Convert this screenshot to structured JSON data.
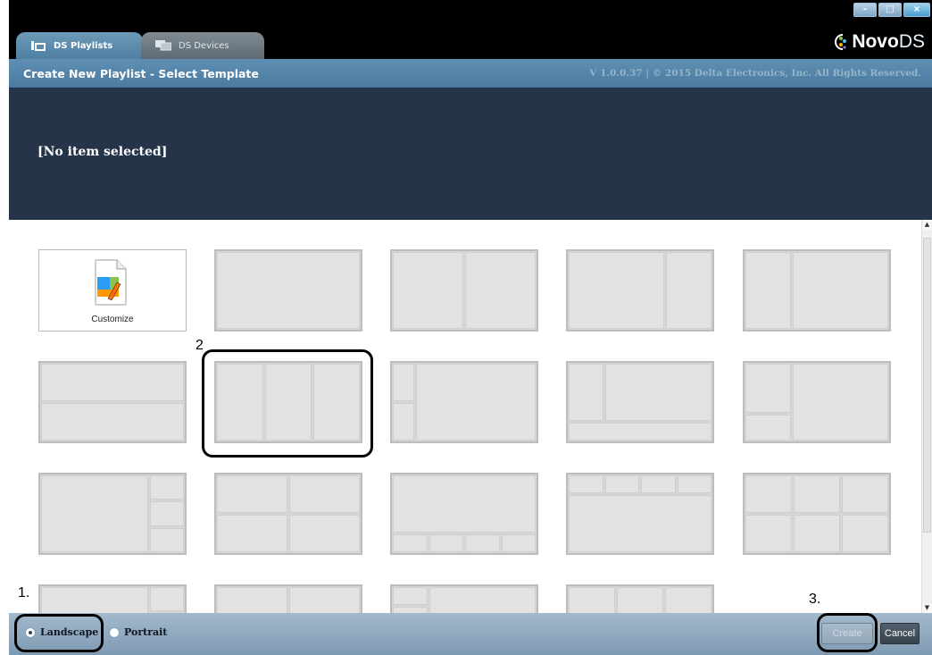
{
  "window": {
    "tabs": [
      {
        "label": "DS Playlists",
        "active": true
      },
      {
        "label": "DS Devices",
        "active": false
      }
    ],
    "controls": {
      "minimize": "-",
      "maximize": "□",
      "close": "×"
    },
    "logo": {
      "novo": "Novo",
      "ds": "DS"
    }
  },
  "header": {
    "title": "Create New Playlist - Select Template",
    "version": "V 1.0.0.37  |  © 2015 Delta Electronics, Inc. All Rights Reserved."
  },
  "banner": {
    "selection": "[No item selected]"
  },
  "templates": {
    "customize_label": "Customize",
    "layouts": [
      {
        "row": 0,
        "col": 1,
        "cells": [
          [
            0,
            0,
            1,
            1
          ]
        ]
      },
      {
        "row": 0,
        "col": 2,
        "cells": [
          [
            0,
            0,
            0.5,
            1
          ],
          [
            0.5,
            0,
            0.5,
            1
          ]
        ]
      },
      {
        "row": 0,
        "col": 3,
        "cells": [
          [
            0,
            0,
            0.67,
            1
          ],
          [
            0.67,
            0,
            0.33,
            1
          ]
        ]
      },
      {
        "row": 0,
        "col": 4,
        "cells": [
          [
            0,
            0,
            0.33,
            1
          ],
          [
            0.33,
            0,
            0.67,
            1
          ]
        ]
      },
      {
        "row": 1,
        "col": 0,
        "cells": [
          [
            0,
            0,
            1,
            0.5
          ],
          [
            0,
            0.5,
            1,
            0.5
          ]
        ]
      },
      {
        "row": 1,
        "col": 1,
        "cells": [
          [
            0,
            0,
            0.333,
            1
          ],
          [
            0.333,
            0,
            0.333,
            1
          ],
          [
            0.666,
            0,
            0.334,
            1
          ]
        ]
      },
      {
        "row": 1,
        "col": 2,
        "cells": [
          [
            0,
            0,
            0.16,
            0.5
          ],
          [
            0,
            0.5,
            0.16,
            0.5
          ],
          [
            0.16,
            0,
            0.84,
            1
          ]
        ]
      },
      {
        "row": 1,
        "col": 3,
        "cells": [
          [
            0,
            0,
            0.25,
            0.75
          ],
          [
            0.25,
            0,
            0.75,
            0.75
          ],
          [
            0,
            0.75,
            1,
            0.25
          ]
        ]
      },
      {
        "row": 1,
        "col": 4,
        "cells": [
          [
            0,
            0,
            0.33,
            0.65
          ],
          [
            0,
            0.65,
            0.33,
            0.35
          ],
          [
            0.33,
            0,
            0.67,
            1
          ]
        ]
      },
      {
        "row": 2,
        "col": 0,
        "cells": [
          [
            0,
            0,
            0.75,
            1
          ],
          [
            0.75,
            0,
            0.25,
            0.333
          ],
          [
            0.75,
            0.333,
            0.25,
            0.333
          ],
          [
            0.75,
            0.666,
            0.25,
            0.334
          ]
        ]
      },
      {
        "row": 2,
        "col": 1,
        "cells": [
          [
            0,
            0,
            0.5,
            0.5
          ],
          [
            0.5,
            0,
            0.5,
            0.5
          ],
          [
            0,
            0.5,
            0.5,
            0.5
          ],
          [
            0.5,
            0.5,
            0.5,
            0.5
          ]
        ]
      },
      {
        "row": 2,
        "col": 2,
        "cells": [
          [
            0,
            0,
            1,
            0.75
          ],
          [
            0,
            0.75,
            0.25,
            0.25
          ],
          [
            0.25,
            0.75,
            0.25,
            0.25
          ],
          [
            0.5,
            0.75,
            0.25,
            0.25
          ],
          [
            0.75,
            0.75,
            0.25,
            0.25
          ]
        ]
      },
      {
        "row": 2,
        "col": 3,
        "cells": [
          [
            0,
            0,
            0.25,
            0.25
          ],
          [
            0.25,
            0,
            0.25,
            0.25
          ],
          [
            0.5,
            0,
            0.25,
            0.25
          ],
          [
            0.75,
            0,
            0.25,
            0.25
          ],
          [
            0,
            0.25,
            1,
            0.75
          ]
        ]
      },
      {
        "row": 2,
        "col": 4,
        "cells": [
          [
            0,
            0,
            0.333,
            0.5
          ],
          [
            0.333,
            0,
            0.333,
            0.5
          ],
          [
            0.666,
            0,
            0.334,
            0.5
          ],
          [
            0,
            0.5,
            0.333,
            0.5
          ],
          [
            0.333,
            0.5,
            0.333,
            0.5
          ],
          [
            0.666,
            0.5,
            0.334,
            0.5
          ]
        ]
      },
      {
        "row": 3,
        "col": 0,
        "cells": [
          [
            0,
            0,
            0.75,
            1
          ],
          [
            0.75,
            0,
            0.25,
            0.333
          ],
          [
            0.75,
            0.333,
            0.25,
            0.333
          ],
          [
            0.75,
            0.666,
            0.25,
            0.334
          ]
        ]
      },
      {
        "row": 3,
        "col": 1,
        "cells": [
          [
            0,
            0,
            0.5,
            0.5
          ],
          [
            0.5,
            0,
            0.5,
            0.5
          ],
          [
            0,
            0.5,
            0.5,
            0.5
          ],
          [
            0.5,
            0.5,
            0.5,
            0.5
          ]
        ]
      },
      {
        "row": 3,
        "col": 2,
        "cells": [
          [
            0,
            0,
            0.25,
            0.25
          ],
          [
            0,
            0.25,
            0.25,
            0.25
          ],
          [
            0,
            0.5,
            0.25,
            0.25
          ],
          [
            0.25,
            0,
            0.75,
            1
          ]
        ]
      },
      {
        "row": 3,
        "col": 3,
        "cells": [
          [
            0,
            0,
            0.333,
            0.5
          ],
          [
            0.333,
            0,
            0.333,
            0.5
          ],
          [
            0.666,
            0,
            0.334,
            0.5
          ],
          [
            0,
            0.5,
            1,
            0.5
          ]
        ]
      }
    ]
  },
  "footer": {
    "orientation": [
      {
        "label": "Landscape",
        "checked": true
      },
      {
        "label": "Portrait",
        "checked": false
      }
    ],
    "create_label": "Create",
    "cancel_label": "Cancel"
  },
  "annotations": {
    "step1": "1.",
    "step2": "2",
    "step3": "3."
  }
}
